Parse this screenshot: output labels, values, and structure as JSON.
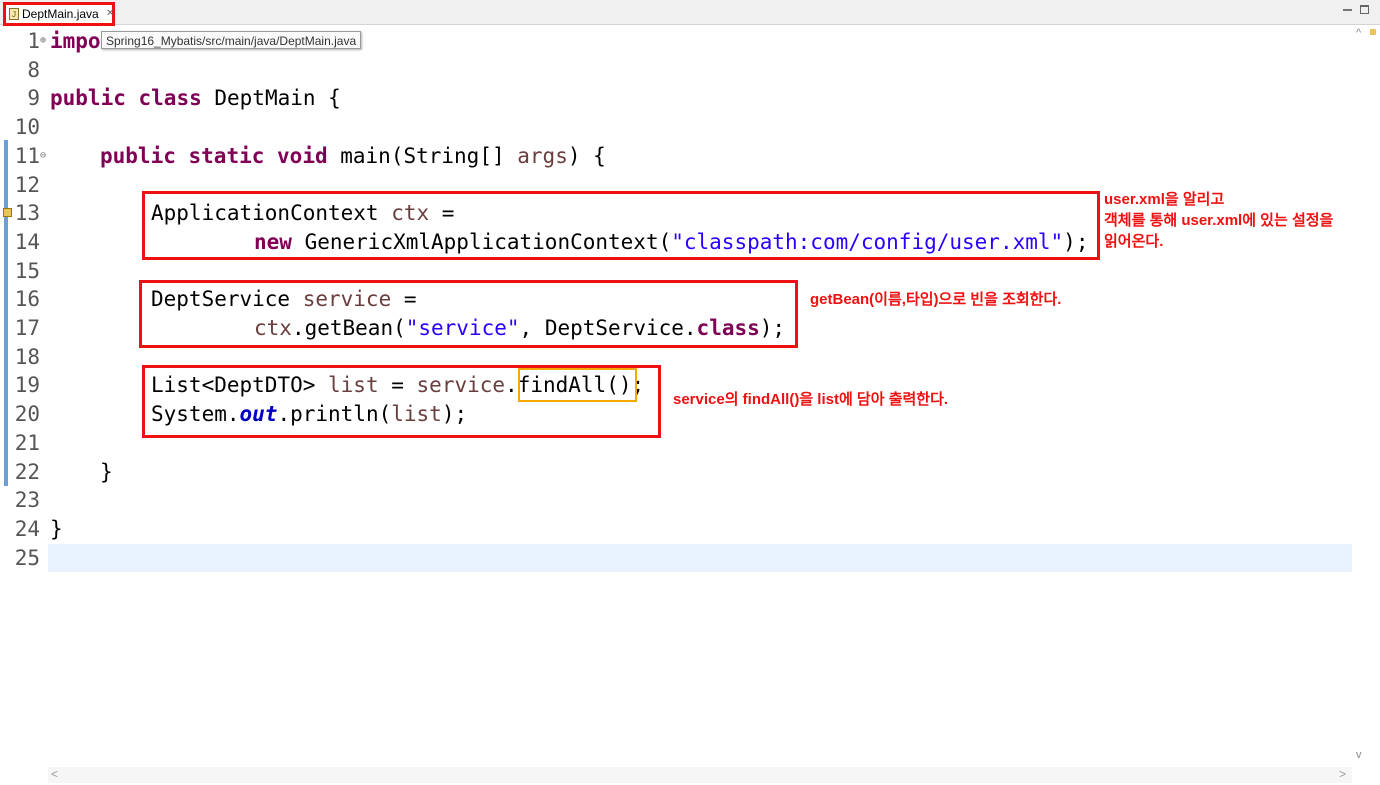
{
  "tab": {
    "icon": "java-file-icon",
    "name": "DeptMain.java",
    "close": "✕"
  },
  "tooltip": "Spring16_Mybatis/src/main/java/DeptMain.java",
  "line_numbers": [
    "1",
    "8",
    "9",
    "10",
    "11",
    "12",
    "13",
    "14",
    "15",
    "16",
    "17",
    "18",
    "19",
    "20",
    "21",
    "22",
    "23",
    "24",
    "25"
  ],
  "code": {
    "l1": {
      "kw": "impo"
    },
    "l9": {
      "kw1": "public",
      "kw2": "class",
      "rest": " DeptMain {"
    },
    "l11": {
      "kw1": "public",
      "kw2": "static",
      "kw3": "void",
      "rest1": " main(String[] ",
      "var": "args",
      "rest2": ") {"
    },
    "l13": {
      "pre": "ApplicationContext ",
      "var": "ctx",
      "post": " ="
    },
    "l14": {
      "kw": "new",
      "pre": " GenericXmlApplicationContext(",
      "str": "\"classpath:com/config/user.xml\"",
      "post": ");"
    },
    "l16": {
      "pre": "DeptService ",
      "var": "service",
      "post": " ="
    },
    "l17": {
      "var": "ctx",
      "pre": ".getBean(",
      "str": "\"service\"",
      "mid": ", DeptService.",
      "kw": "class",
      "post": ");"
    },
    "l19": {
      "pre": "List<DeptDTO> ",
      "var1": "list",
      "mid": " = ",
      "var2": "service",
      "post": ".findAll();"
    },
    "l20": {
      "pre": "System.",
      "field": "out",
      "mid": ".println(",
      "var": "list",
      "post": ");"
    },
    "l22": {
      "text": "}"
    },
    "l24": {
      "text": "}"
    }
  },
  "notes": {
    "n1_l1": "user.xml을 알리고",
    "n1_l2": "객체를 통해 user.xml에 있는 설정을",
    "n1_l3": "읽어온다.",
    "n2": "getBean(이름,타입)으로 빈을 조회한다.",
    "n3": "service의 findAll()을 list에 담아 출력한다."
  },
  "colors": {
    "keyword": "#7f0055",
    "string": "#2a00ff",
    "variable": "#6a3e3e",
    "field": "#0000c0",
    "annotation": "#ee1111",
    "highlight": "#f2a900",
    "current_line": "#e8f2fe"
  }
}
